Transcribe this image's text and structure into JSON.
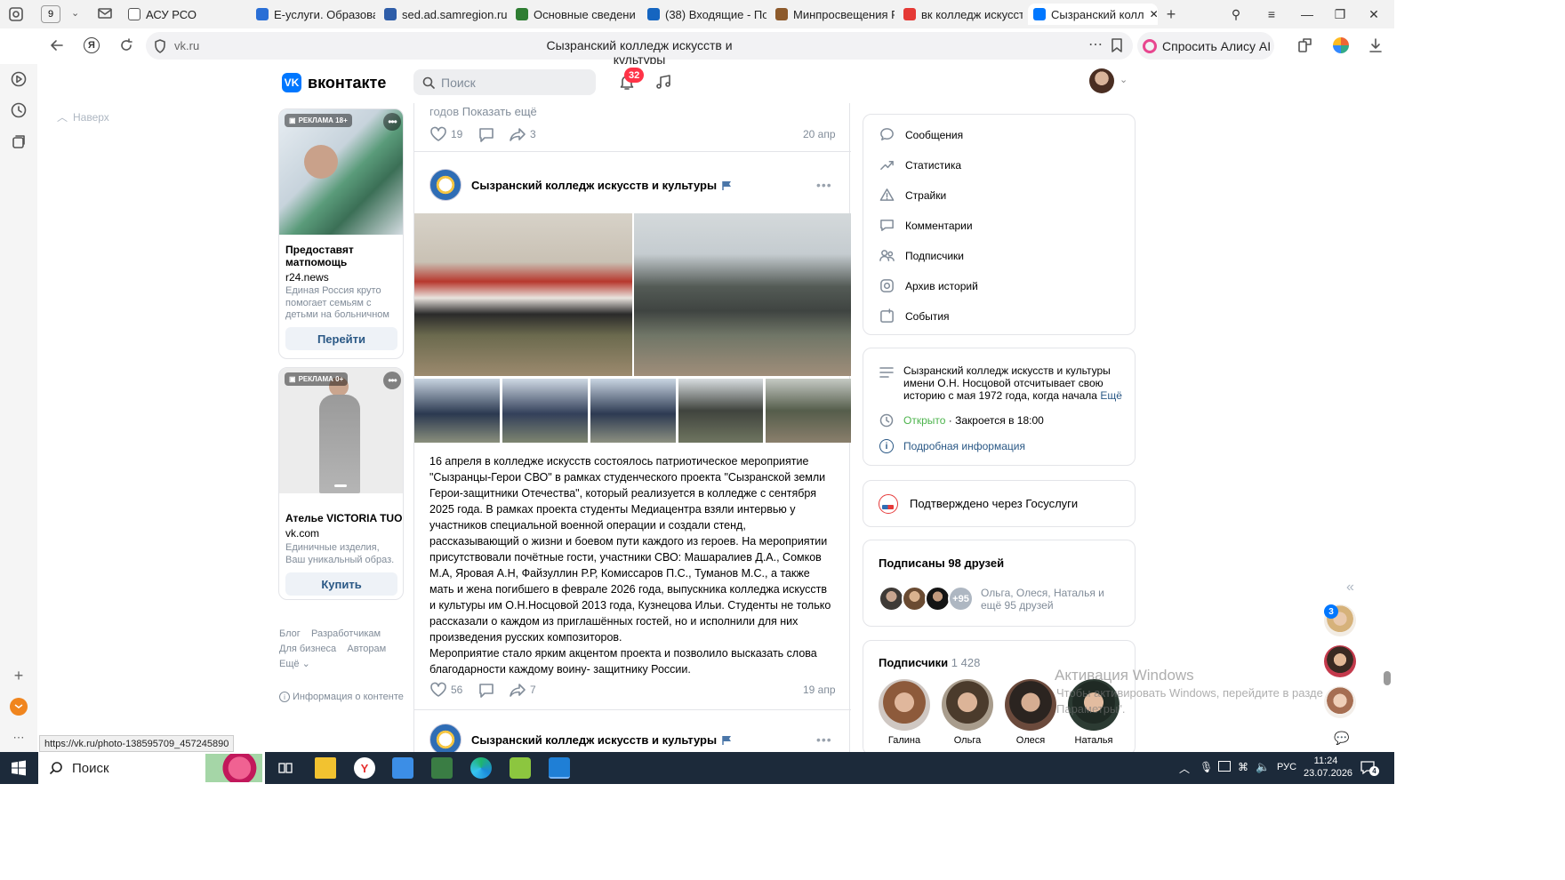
{
  "browser": {
    "tab_counter": "9",
    "tabs": [
      {
        "label": "АСУ РСО",
        "color": "#ffffff",
        "icon": "page-icon"
      },
      {
        "label": "Е-услуги. Образова",
        "color": "#2a6fd6",
        "icon": "e-services-icon"
      },
      {
        "label": "sed.ad.samregion.ru",
        "color": "#2e5da8",
        "icon": "sed-icon"
      },
      {
        "label": "Основные сведени",
        "color": "#2e7d32",
        "icon": "school-icon"
      },
      {
        "label": "(38) Входящие - По",
        "color": "#1565c0",
        "icon": "mail-icon"
      },
      {
        "label": "Минпросвещения Р",
        "color": "#8d5a2b",
        "icon": "emblem-icon"
      },
      {
        "label": "вк колледж искусст",
        "color": "#e53935",
        "icon": "yandex-icon"
      },
      {
        "label": "Сызранский колл",
        "color": "#0077ff",
        "icon": "vk-icon"
      }
    ],
    "address": "vk.ru",
    "page_title": "Сызранский колледж искусств и культуры",
    "alice_label": "Спросить Алису AI",
    "status_url": "https://vk.ru/photo-138595709_457245890"
  },
  "vk": {
    "logo_text": "вконтакте",
    "search_placeholder": "Поиск",
    "notifications": "32",
    "back_to_top": "Наверх",
    "ads": [
      {
        "badge": "РЕКЛАМА 18+",
        "title": "Предоставят матпомощь",
        "domain": "r24.news",
        "desc": "Единая Россия круто помогает семьям с детьми на больничном",
        "button": "Перейти"
      },
      {
        "badge": "РЕКЛАМА 0+",
        "title": "Ателье VICTORIA TUO",
        "domain": "vk.com",
        "desc": "Единичные изделия, Ваш уникальный образ.",
        "button": "Купить"
      }
    ],
    "footer_links": [
      "Блог",
      "Разработчикам",
      "Для бизнеса",
      "Авторам",
      "Ещё"
    ],
    "content_info": "Информация о контенте",
    "prev_post": {
      "text_tail": "годов",
      "show_more": "Показать ещё",
      "likes": "19",
      "shares": "3",
      "date": "20 апр"
    },
    "post": {
      "author": "Сызранский колледж искусств и культуры",
      "text": "16 апреля в колледже искусств состоялось патриотическое мероприятие \"Сызранцы-Герои СВО\" в рамках студенческого проекта \"Сызранской земли Герои-защитники Отечества\", который реализуется в колледже с сентября 2025 года. В рамках проекта студенты Медиацентра взяли интервью у участников специальной военной операции и создали стенд, рассказывающий о жизни и боевом пути каждого из героев. На мероприятии присутствовали почётные гости, участники СВО: Машаралиев Д.А., Сомков М.А, Яровая А.Н, Файзуллин Р.Р, Комиссаров П.С., Туманов М.С., а также мать и жена погибшего в феврале 2026 года, выпускника колледжа искусств и культуры им О.Н.Носцовой 2013 года, Кузнецова Ильи. Студенты не только рассказали о каждом из приглашённых гостей, но и исполнили для них произведения русских композиторов.",
      "text2": "Мероприятие стало ярким акцентом проекта и позволило высказать слова благодарности каждому воину- защитнику России.",
      "likes": "56",
      "shares": "7",
      "date": "19 апр"
    },
    "next_post": {
      "author": "Сызранский колледж искусств и культуры"
    },
    "side_menu": [
      "Сообщения",
      "Статистика",
      "Страйки",
      "Комментарии",
      "Подписчики",
      "Архив историй",
      "События"
    ],
    "about": {
      "text": "Сызранский колледж искусств и культуры имени О.Н. Носцовой отсчитывает свою историю с мая 1972 года, когда начала",
      "more": "Ещё",
      "open": "Открыто",
      "closes": "Закроется в 18:00",
      "details": "Подробная информация"
    },
    "gosuslugi": "Подтверждено через Госуслуги",
    "friends": {
      "title": "Подписаны 98 друзей",
      "extra": "+95",
      "names": "Ольга, Олеся, Наталья и ещё 95 друзей"
    },
    "followers": {
      "title": "Подписчики",
      "count": "1 428",
      "people": [
        "Галина",
        "Ольга",
        "Олеся",
        "Наталья"
      ]
    },
    "chat_badge": "3"
  },
  "watermark": {
    "line1": "Активация Windows",
    "line2": "Чтобы активировать Windows, перейдите в разде",
    "line3": "Параметры\"."
  },
  "taskbar": {
    "search": "Поиск",
    "lang": "РУС",
    "time": "11:24",
    "date": "23.07.2026",
    "notif_count": "4"
  }
}
